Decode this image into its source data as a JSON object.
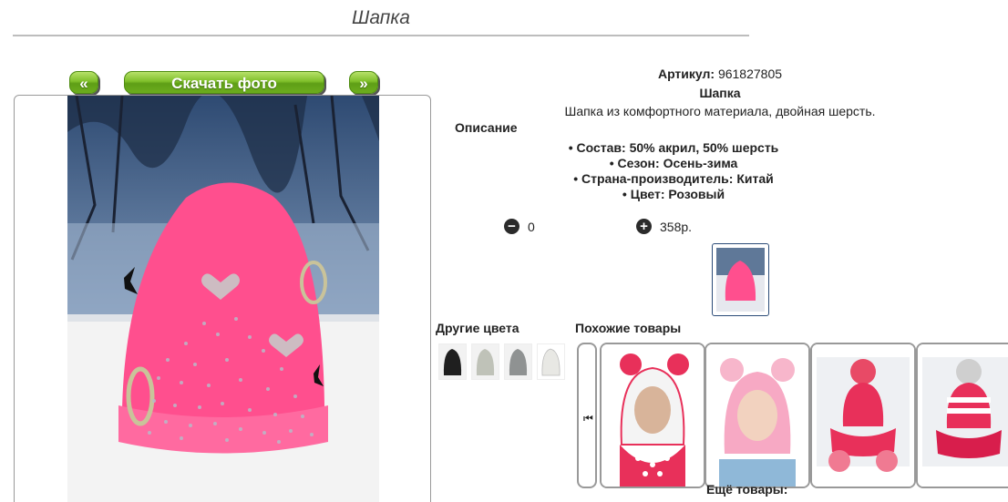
{
  "page": {
    "title": "Шапка"
  },
  "gallery": {
    "prev_label": "«",
    "download_label": "Скачать фото",
    "next_label": "»"
  },
  "product": {
    "article_label": "Артикул:",
    "article_value": "961827805",
    "name": "Шапка",
    "short_description": "Шапка из комфортного материала, двойная шерсть.",
    "description_title": "Описание",
    "specs": [
      "Состав: 50% акрил, 50% шерсть",
      "Сезон: Осень-зима",
      "Страна-производитель: Китай",
      "Цвет: Розовый"
    ],
    "quantity": "0",
    "price": "358р.",
    "product_color": "#ff4f8e"
  },
  "other_colors": {
    "title": "Другие цвета",
    "swatches": [
      "#1f1f1f",
      "#bfc2b8",
      "#8f9292",
      "#e8e8e4"
    ]
  },
  "similar": {
    "title": "Похожие товары",
    "scroll_icon": "skip-back-icon",
    "items": [
      "pink-balaclava-polka-dots",
      "pink-balaclava-pompoms",
      "pink-hat-with-scarf",
      "pink-striped-hat-with-scarf"
    ]
  },
  "more_label": "Ещё товары:"
}
